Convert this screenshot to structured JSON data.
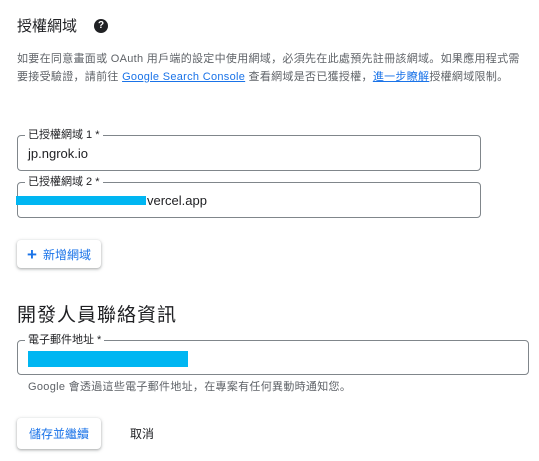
{
  "authorized_domains": {
    "title": "授權網域",
    "help_icon": "help-circle-icon",
    "description_part1": "如要在同意畫面或 OAuth 用戶端的設定中使用網域，必須先在此處預先註冊該網域。如果應用程式需要接受驗證，請前往 ",
    "search_console_link": "Google Search Console",
    "description_part2": " 查看網域是否已獲授權，",
    "learn_more_link": "進一步瞭解",
    "description_part3": "授權網域限制。",
    "domain1_label": "已授權網域 1 *",
    "domain1_value": "jp.ngrok.io",
    "domain2_label": "已授權網域 2 *",
    "domain2_value": "vercel.app",
    "add_domain_label": "新增網域",
    "add_icon": "plus-icon"
  },
  "developer_contact": {
    "title": "開發人員聯絡資訊",
    "email_label": "電子郵件地址 *",
    "hint": "Google 會透過這些電子郵件地址，在專案有任何異動時通知您。"
  },
  "actions": {
    "save_label": "儲存並繼續",
    "cancel_label": "取消"
  },
  "colors": {
    "accent": "#1a73e8",
    "redaction": "#00b6f2"
  }
}
